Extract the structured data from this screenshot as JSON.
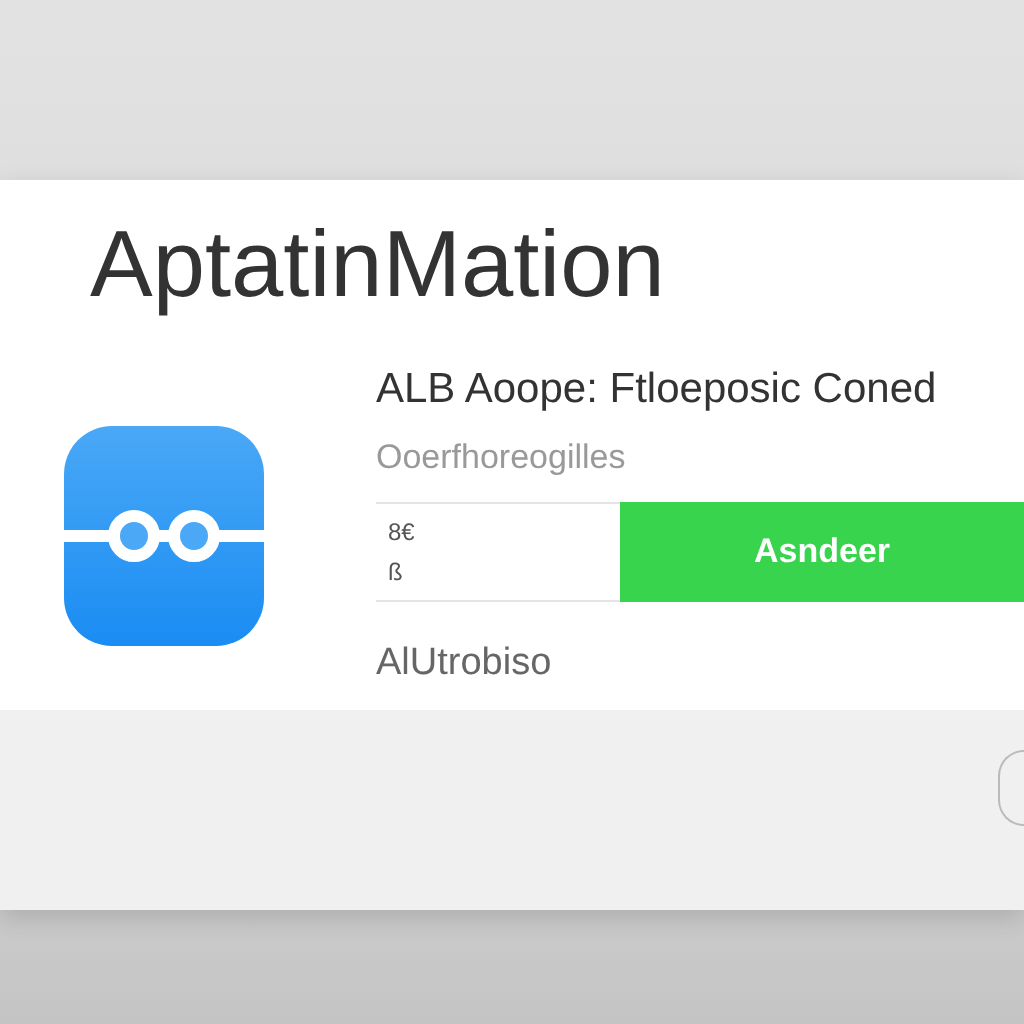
{
  "title": "AptatinMation",
  "app": {
    "heading": "ALB Aoope: Ftloeposic Coned",
    "subtitle": "Ooerfhoreogilles",
    "field_lines": [
      "8€",
      "ß"
    ],
    "action_button": "Asndeer",
    "caption": "AlUtrobiso"
  }
}
